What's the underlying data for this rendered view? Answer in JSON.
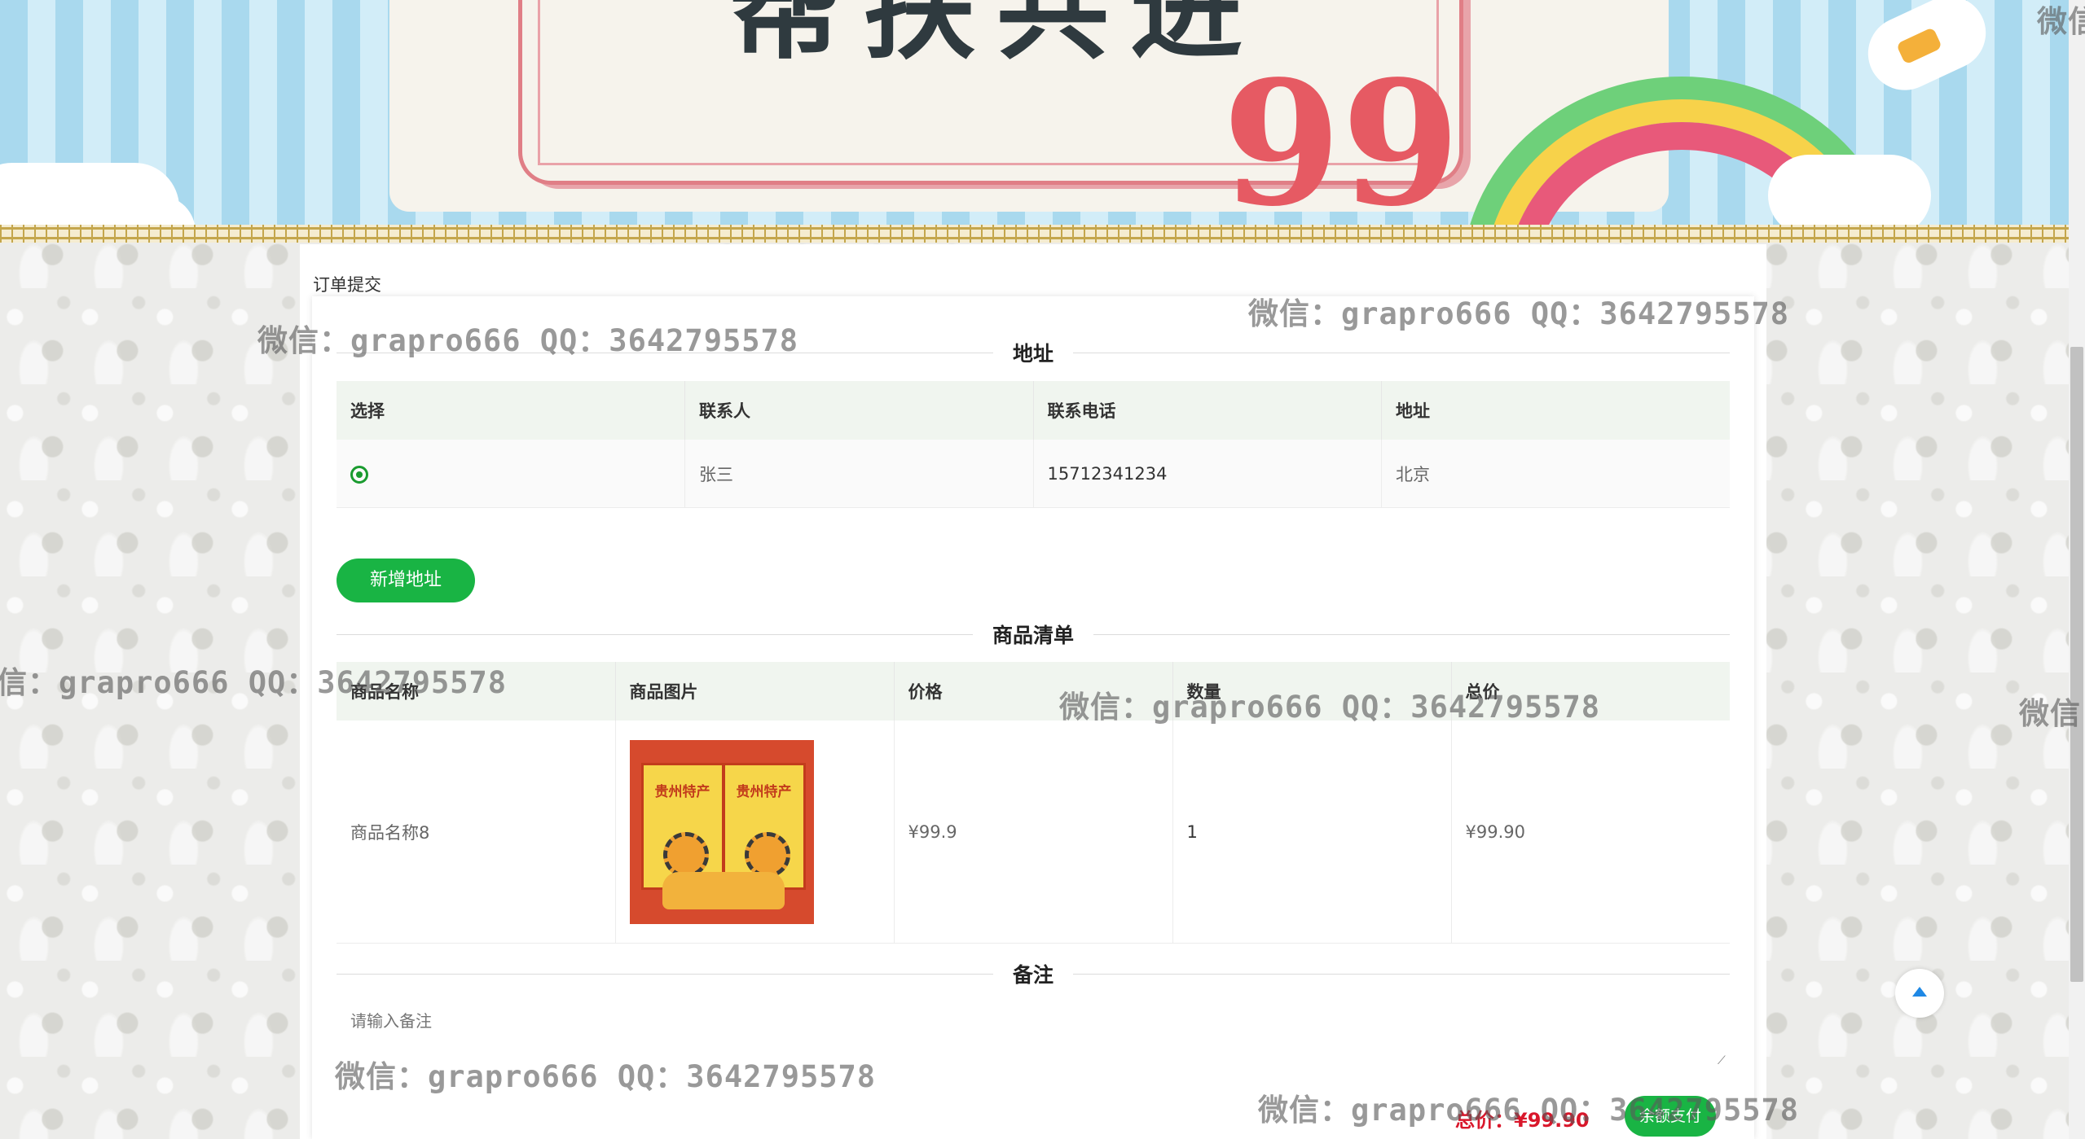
{
  "banner": {
    "title": "帮扶共进",
    "quote": "99"
  },
  "page": {
    "label": "订单提交"
  },
  "address_section": {
    "title": "地址",
    "columns": [
      "选择",
      "联系人",
      "联系电话",
      "地址"
    ],
    "rows": [
      {
        "contact": "张三",
        "phone": "15712341234",
        "address": "北京"
      }
    ],
    "add_button": "新增地址"
  },
  "goods_section": {
    "title": "商品清单",
    "columns": [
      "商品名称",
      "商品图片",
      "价格",
      "数量",
      "总价"
    ],
    "rows": [
      {
        "name": "商品名称8",
        "image_text": "贵州特产",
        "price": "¥99.9",
        "quantity": "1",
        "subtotal": "¥99.90"
      }
    ]
  },
  "remark_section": {
    "title": "备注",
    "placeholder": "请输入备注"
  },
  "footer": {
    "total_label": "总价：",
    "total_value": "¥99.90",
    "pay_button": "余额支付"
  },
  "watermarks": [
    "微信：grapro666 QQ：3642795578",
    "微信：grapro666 QQ：3642795578",
    "信：grapro666 QQ：3642795578",
    "微信：grapro666 QQ：3642795578",
    "微信：grapro666 QQ：3642795578",
    "微信：grapro666 QQ：3642795578",
    "微信",
    "微信"
  ],
  "colors": {
    "primary_green": "#19b444",
    "price_red": "#d9172b",
    "header_bg": "#f0f5ef",
    "radio_green": "#1a9b2f"
  }
}
